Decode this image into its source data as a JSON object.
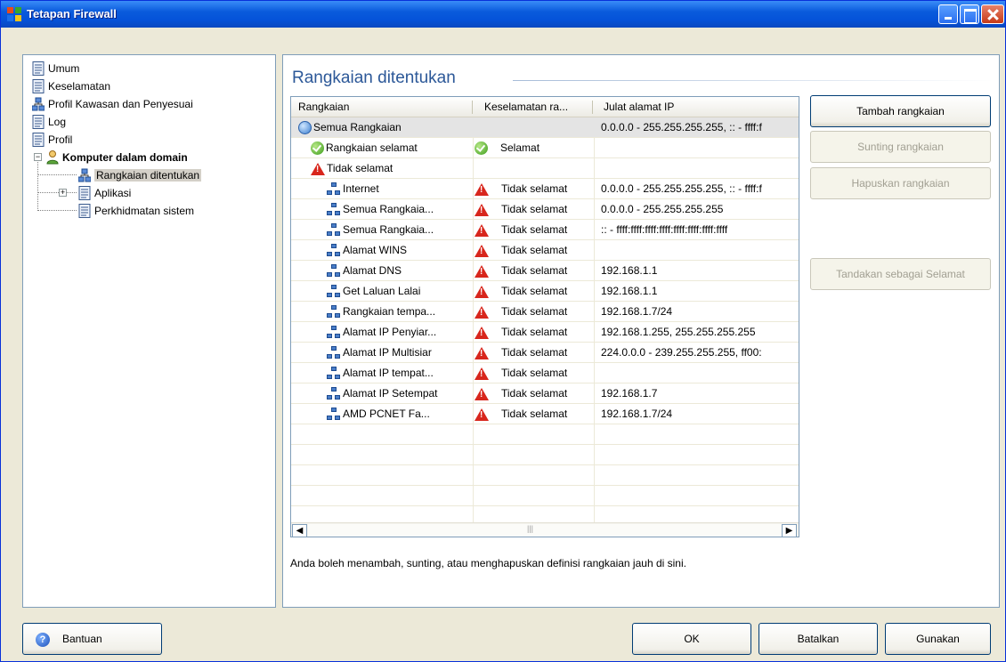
{
  "window": {
    "title": "Tetapan Firewall"
  },
  "sidebar": {
    "items": [
      {
        "label": "Umum",
        "icon": "document-icon"
      },
      {
        "label": "Keselamatan",
        "icon": "document-icon"
      },
      {
        "label": "Profil Kawasan dan Penyesuai",
        "icon": "network-icon"
      },
      {
        "label": "Log",
        "icon": "document-icon"
      },
      {
        "label": "Profil",
        "icon": "document-icon"
      },
      {
        "label": "Komputer dalam domain",
        "icon": "user-icon",
        "expanded": true
      },
      {
        "label": "Rangkaian ditentukan",
        "icon": "network-icon",
        "selected": true
      },
      {
        "label": "Aplikasi",
        "icon": "document-icon",
        "expanded": false
      },
      {
        "label": "Perkhidmatan sistem",
        "icon": "document-icon"
      }
    ]
  },
  "main": {
    "title": "Rangkaian ditentukan",
    "columns": [
      "Rangkaian",
      "Keselamatan ra...",
      "Julat alamat IP"
    ],
    "rows": [
      {
        "name": "Semua Rangkaian",
        "status": "",
        "ip": "0.0.0.0 - 255.255.255.255, :: - ffff:f",
        "icon": "globe-icon",
        "status_icon": ""
      },
      {
        "name": "Rangkaian selamat",
        "status": "Selamat",
        "ip": "",
        "icon": "check-icon",
        "status_icon": "check-icon"
      },
      {
        "name": "Tidak selamat",
        "status": "",
        "ip": "",
        "icon": "warning-icon",
        "status_icon": ""
      },
      {
        "name": "Internet",
        "status": "Tidak selamat",
        "ip": "0.0.0.0 - 255.255.255.255, :: - ffff:f",
        "icon": "network-icon",
        "status_icon": "warning-icon"
      },
      {
        "name": "Semua Rangkaia...",
        "status": "Tidak selamat",
        "ip": "0.0.0.0 - 255.255.255.255",
        "icon": "network-icon",
        "status_icon": "warning-icon"
      },
      {
        "name": "Semua Rangkaia...",
        "status": "Tidak selamat",
        "ip": ":: - ffff:ffff:ffff:ffff:ffff:ffff:ffff:ffff",
        "icon": "network-icon",
        "status_icon": "warning-icon"
      },
      {
        "name": "Alamat WINS",
        "status": "Tidak selamat",
        "ip": "",
        "icon": "network-icon",
        "status_icon": "warning-icon"
      },
      {
        "name": "Alamat DNS",
        "status": "Tidak selamat",
        "ip": "192.168.1.1",
        "icon": "network-icon",
        "status_icon": "warning-icon"
      },
      {
        "name": "Get Laluan Lalai",
        "status": "Tidak selamat",
        "ip": "192.168.1.1",
        "icon": "network-icon",
        "status_icon": "warning-icon"
      },
      {
        "name": "Rangkaian tempa...",
        "status": "Tidak selamat",
        "ip": "192.168.1.7/24",
        "icon": "network-icon",
        "status_icon": "warning-icon"
      },
      {
        "name": "Alamat IP Penyiar...",
        "status": "Tidak selamat",
        "ip": "192.168.1.255, 255.255.255.255",
        "icon": "network-icon",
        "status_icon": "warning-icon"
      },
      {
        "name": "Alamat IP Multisiar",
        "status": "Tidak selamat",
        "ip": "224.0.0.0 - 239.255.255.255, ff00:",
        "icon": "network-icon",
        "status_icon": "warning-icon"
      },
      {
        "name": "Alamat IP tempat...",
        "status": "Tidak selamat",
        "ip": "",
        "icon": "network-icon",
        "status_icon": "warning-icon"
      },
      {
        "name": "Alamat IP Setempat",
        "status": "Tidak selamat",
        "ip": "192.168.1.7",
        "icon": "network-icon",
        "status_icon": "warning-icon"
      },
      {
        "name": "AMD PCNET Fa...",
        "status": "Tidak selamat",
        "ip": "192.168.1.7/24",
        "icon": "network-icon",
        "status_icon": "warning-icon"
      }
    ],
    "help_text": "Anda boleh menambah, sunting, atau menghapuskan definisi rangkaian jauh di sini."
  },
  "actions": {
    "add": "Tambah rangkaian",
    "edit": "Sunting rangkaian",
    "delete": "Hapuskan rangkaian",
    "mark_safe": "Tandakan sebagai Selamat"
  },
  "footer": {
    "help": "Bantuan",
    "ok": "OK",
    "cancel": "Batalkan",
    "apply": "Gunakan"
  },
  "colors": {
    "title_blue": "#2c5898",
    "titlebar": "#0553d9",
    "warning_red": "#d8261c",
    "ok_green": "#3b9c1a"
  }
}
